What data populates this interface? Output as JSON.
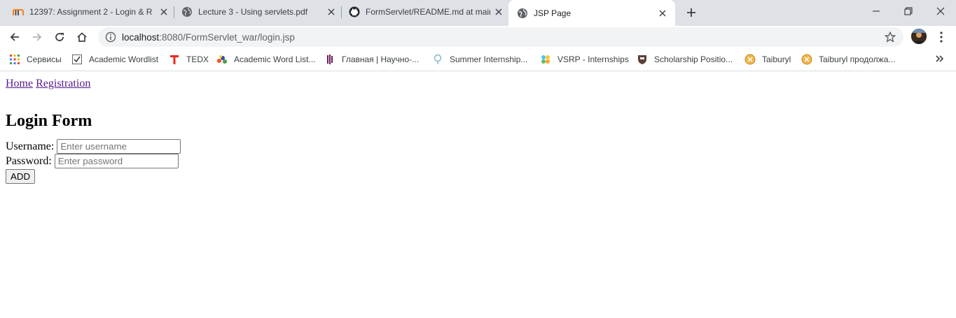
{
  "browser": {
    "tabs": [
      {
        "title": "12397: Assignment 2 - Login & R",
        "icon": "moodle-icon",
        "active": false
      },
      {
        "title": "Lecture 3 - Using servlets.pdf",
        "icon": "globe-icon",
        "active": false
      },
      {
        "title": "FormServlet/README.md at mair",
        "icon": "github-icon",
        "active": false
      },
      {
        "title": "JSP Page",
        "icon": "globe-icon",
        "active": true
      }
    ],
    "url_host": "localhost",
    "url_rest": ":8080/FormServlet_war/login.jsp",
    "bookmarks": [
      {
        "label": "Сервисы",
        "icon": "apps-grid-icon"
      },
      {
        "label": "Academic Wordlist",
        "icon": "checkbox-icon"
      },
      {
        "label": "TEDX",
        "icon": "tedx-icon"
      },
      {
        "label": "Academic Word List...",
        "icon": "colorful-icon"
      },
      {
        "label": "Главная | Научно-...",
        "icon": "purple-bars-icon"
      },
      {
        "label": "Summer Internship...",
        "icon": "tree-icon"
      },
      {
        "label": "VSRP - Internships",
        "icon": "dots-icon"
      },
      {
        "label": "Scholarship Positio...",
        "icon": "shield-icon"
      },
      {
        "label": "Taiburyl",
        "icon": "gold-coin-icon"
      },
      {
        "label": "Taiburyl продолжа...",
        "icon": "gold-coin-icon"
      }
    ]
  },
  "page": {
    "nav": {
      "home": "Home",
      "registration": "Registration"
    },
    "heading": "Login Form",
    "username_label": "Username:",
    "username_placeholder": "Enter username",
    "password_label": "Password:",
    "password_placeholder": "Enter password",
    "submit_label": "ADD"
  },
  "colors": {
    "link_visited": "#551a8b",
    "tabstrip": "#dee1e6",
    "omnibox": "#f1f3f4"
  }
}
